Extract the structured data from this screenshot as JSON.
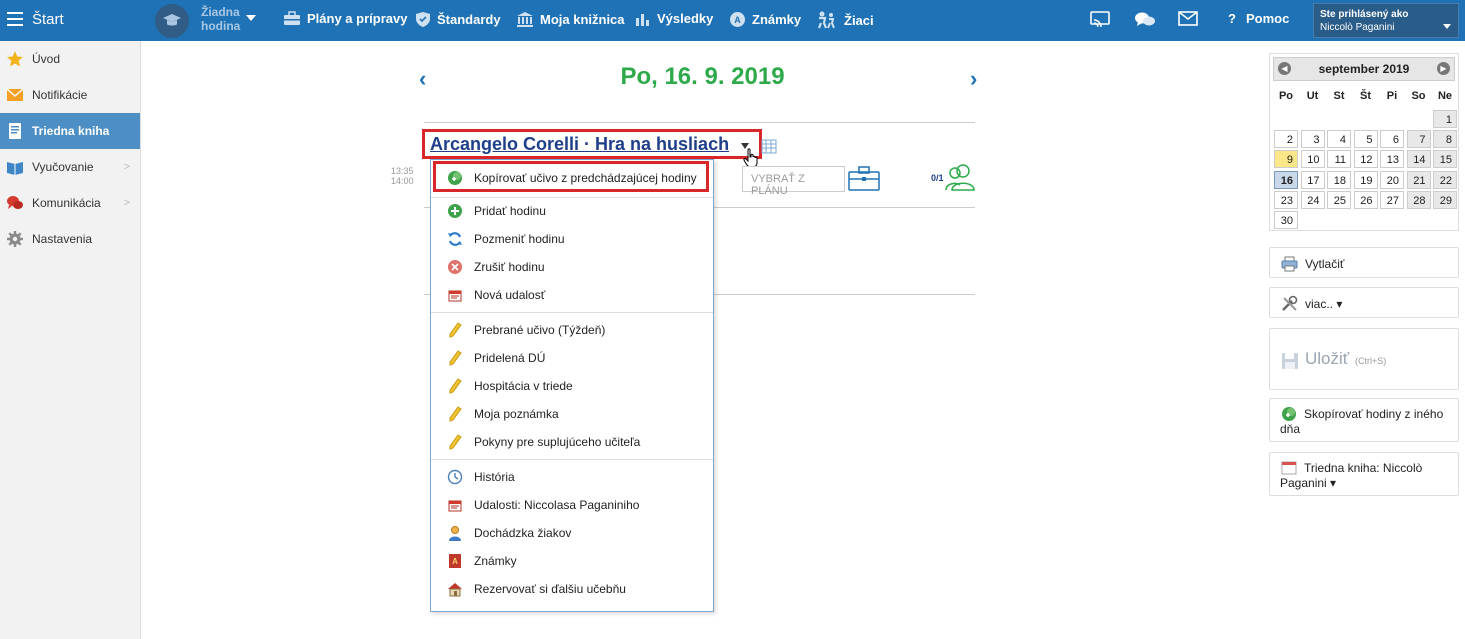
{
  "topbar": {
    "menu_label": "Štart",
    "lesson_line1": "Žiadna",
    "lesson_line2": "hodina",
    "nav": [
      {
        "label": "Plány a prípravy",
        "icon": "briefcase-icon"
      },
      {
        "label": "Štandardy",
        "icon": "shield-icon"
      },
      {
        "label": "Moja knižnica",
        "icon": "library-icon"
      },
      {
        "label": "Výsledky",
        "icon": "bar-chart-icon"
      },
      {
        "label": "Známky",
        "icon": "grades-icon"
      },
      {
        "label": "Žiaci",
        "icon": "students-icon"
      }
    ],
    "help_label": "Pomoc",
    "help_symbol": "?",
    "user_line1": "Ste prihlásený ako",
    "user_line2": "Niccolò Paganini"
  },
  "sidebar": {
    "items": [
      {
        "label": "Úvod",
        "icon": "star-icon"
      },
      {
        "label": "Notifikácie",
        "icon": "envelope-icon"
      },
      {
        "label": "Triedna kniha",
        "icon": "book-icon",
        "active": true
      },
      {
        "label": "Vyučovanie",
        "icon": "open-book-icon"
      },
      {
        "label": "Komunikácia",
        "icon": "chat-icon"
      },
      {
        "label": "Nastavenia",
        "icon": "gear-icon"
      }
    ]
  },
  "main": {
    "date": "Po, 16. 9. 2019",
    "prev_symbol": "‹",
    "next_symbol": "›",
    "lesson_title": "Arcangelo Corelli · Hra na husliach",
    "time_start": "13:35",
    "time_end": "14:00",
    "plan_button": "VYBRAŤ Z PLÁNU",
    "student_count": "0/1"
  },
  "dropdown": {
    "items": [
      {
        "label": "Kopírovať učivo z predchádzajúcej hodiny",
        "icon": "copy-plus-icon"
      },
      {
        "label": "Pridať hodinu",
        "icon": "add-icon"
      },
      {
        "label": "Pozmeniť hodinu",
        "icon": "refresh-icon"
      },
      {
        "label": "Zrušiť hodinu",
        "icon": "cancel-icon"
      },
      {
        "label": "Nová udalosť",
        "icon": "calendar-event-icon"
      },
      {
        "label": "Prebrané učivo (Týždeň)",
        "icon": "pencil-icon"
      },
      {
        "label": "Pridelená DÚ",
        "icon": "pencil-icon"
      },
      {
        "label": "Hospitácia v triede",
        "icon": "pencil-icon"
      },
      {
        "label": "Moja poznámka",
        "icon": "pencil-icon"
      },
      {
        "label": "Pokyny pre suplujúceho učiteľa",
        "icon": "pencil-icon"
      },
      {
        "label": "História",
        "icon": "clock-icon"
      },
      {
        "label": "Udalosti: Niccolasa Paganiniho",
        "icon": "calendar-event-icon"
      },
      {
        "label": "Dochádzka žiakov",
        "icon": "person-icon"
      },
      {
        "label": "Známky",
        "icon": "grade-book-icon"
      },
      {
        "label": "Rezervovať si ďalšiu učebňu",
        "icon": "room-icon"
      }
    ]
  },
  "calendar": {
    "month_label": "september 2019",
    "weekdays": [
      "Po",
      "Ut",
      "St",
      "Št",
      "Pi",
      "So",
      "Ne"
    ],
    "days": [
      "1",
      "2",
      "3",
      "4",
      "5",
      "6",
      "7",
      "8",
      "9",
      "10",
      "11",
      "12",
      "13",
      "14",
      "15",
      "16",
      "17",
      "18",
      "19",
      "20",
      "21",
      "22",
      "23",
      "24",
      "25",
      "26",
      "27",
      "28",
      "29",
      "30"
    ],
    "today": "9",
    "selected": "16"
  },
  "right_panel": {
    "print_label": "Vytlačiť",
    "more_label": "viac.. ▾",
    "save_label": "Uložiť",
    "save_shortcut": "(Ctrl+S)",
    "copy_day_label": "Skopírovať hodiny z iného dňa",
    "class_book_label": "Triedna kniha: Niccolò Paganini ▾"
  }
}
